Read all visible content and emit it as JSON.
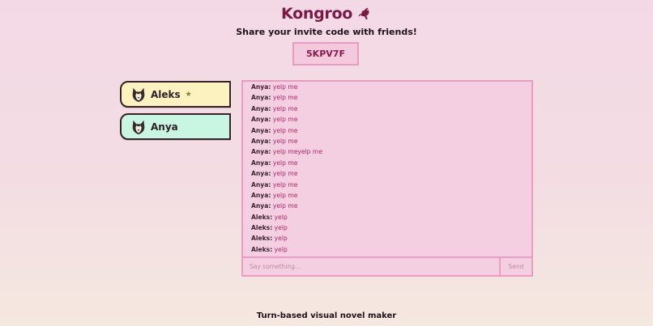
{
  "header": {
    "brand": "Kongroo",
    "subtitle": "Share your invite code with friends!",
    "invite_code": "5KPV7F"
  },
  "players": [
    {
      "name": "Aleks",
      "is_host": true,
      "host_mark": "★",
      "color": "#fbf2c0"
    },
    {
      "name": "Anya",
      "is_host": false,
      "color": "#c9f5e3"
    }
  ],
  "chat": {
    "messages": [
      {
        "author": "Anya:",
        "text": "yelp me"
      },
      {
        "author": "Anya:",
        "text": "yelp me"
      },
      {
        "author": "Anya:",
        "text": "yelp me"
      },
      {
        "author": "Anya:",
        "text": "yelp me"
      },
      {
        "author": "Anya:",
        "text": "yelp me"
      },
      {
        "author": "Anya:",
        "text": "yelp me"
      },
      {
        "author": "Anya:",
        "text": "yelp meyelp me"
      },
      {
        "author": "Anya:",
        "text": "yelp me"
      },
      {
        "author": "Anya:",
        "text": "yelp me"
      },
      {
        "author": "Anya:",
        "text": "yelp me"
      },
      {
        "author": "Anya:",
        "text": "yelp me"
      },
      {
        "author": "Anya:",
        "text": "yelp me"
      },
      {
        "author": "Aleks:",
        "text": "yelp"
      },
      {
        "author": "Aleks:",
        "text": "yelp"
      },
      {
        "author": "Aleks:",
        "text": "yelp"
      },
      {
        "author": "Aleks:",
        "text": "yelp"
      }
    ],
    "input_placeholder": "Say something...",
    "send_label": "Send"
  },
  "footer": {
    "tagline": "Turn-based visual novel maker"
  },
  "colors": {
    "brand": "#7a1946",
    "accent_pink": "#ec9cc1",
    "message_text": "#b2266a"
  },
  "icons": {
    "brand_icon": "kangaroo-icon",
    "player_avatar": "husky-icon"
  }
}
